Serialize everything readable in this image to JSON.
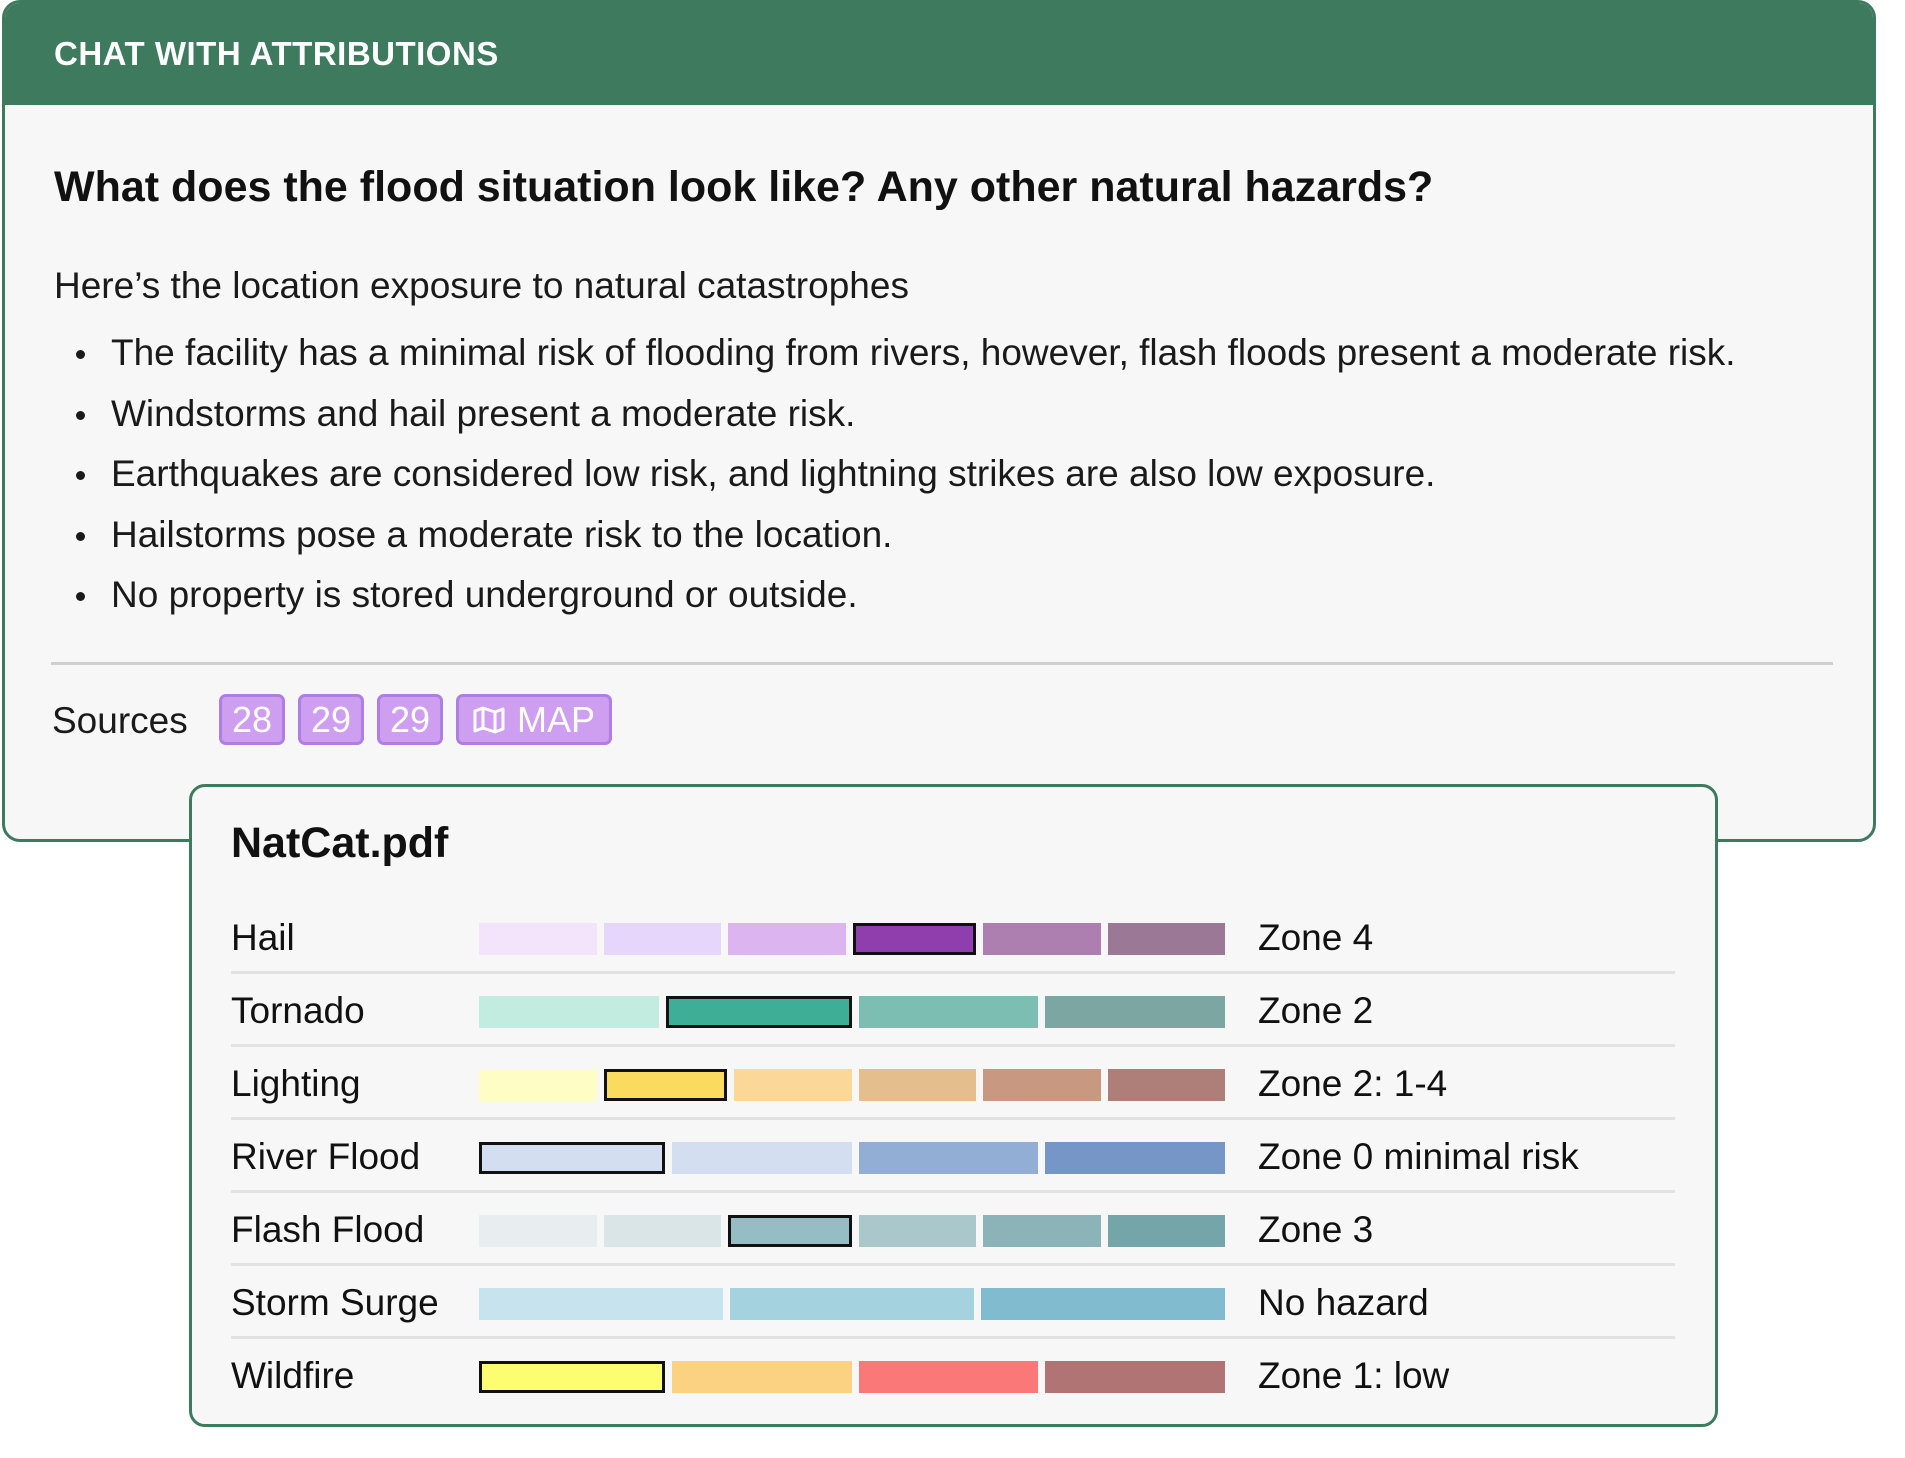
{
  "header": {
    "title": "CHAT WITH ATTRIBUTIONS"
  },
  "chat": {
    "question": "What does the flood situation look like? Any other natural hazards?",
    "intro": "Here’s the location exposure to natural catastrophes",
    "bullets": [
      "The facility has a minimal risk of flooding from rivers, however, flash floods present a moderate risk.",
      "Windstorms and hail present a moderate risk.",
      "Earthquakes are considered low risk, and lightning strikes are also low exposure.",
      "Hailstorms pose a moderate risk to the location.",
      "No property is stored underground or outside."
    ]
  },
  "sources": {
    "label": "Sources",
    "chips": [
      "28",
      "29",
      "29"
    ],
    "map_label": "MAP",
    "map_icon": "map-icon"
  },
  "pdf": {
    "title": "NatCat.pdf",
    "rows": [
      {
        "label": "Hail",
        "zone": "Zone 4",
        "selected": 3,
        "colors": [
          "#f3e4fb",
          "#e7d6fb",
          "#dcb5f0",
          "#8e3fad",
          "#ad7fb0",
          "#9b7895"
        ]
      },
      {
        "label": "Tornado",
        "zone": "Zone 2",
        "selected": 1,
        "colors": [
          "#c3ece0",
          "#3eae97",
          "#7dbeb3",
          "#7ba6a2"
        ]
      },
      {
        "label": "Lighting",
        "zone": "Zone 2: 1-4",
        "selected": 1,
        "colors": [
          "#fefec4",
          "#fbdb5e",
          "#fbd898",
          "#e5be8d",
          "#c99880",
          "#ae7f79"
        ]
      },
      {
        "label": "River Flood",
        "zone": "Zone 0 minimal risk",
        "selected": 0,
        "colors": [
          "#d3dff0",
          "#d3dff0",
          "#92aed5",
          "#7796c8"
        ]
      },
      {
        "label": "Flash Flood",
        "zone": "Zone 3",
        "selected": 2,
        "colors": [
          "#e8eef0",
          "#d9e5e7",
          "#96bdc3",
          "#aac8cc",
          "#8cb3b8",
          "#74a5a9"
        ]
      },
      {
        "label": "Storm Surge",
        "zone": "No hazard",
        "selected": -1,
        "colors": [
          "#c6e3ee",
          "#a4d2de",
          "#80bbcf"
        ]
      },
      {
        "label": "Wildfire",
        "zone": "Zone 1: low",
        "selected": 0,
        "colors": [
          "#fdfd72",
          "#fbd182",
          "#fb7878",
          "#b07474"
        ]
      }
    ]
  }
}
